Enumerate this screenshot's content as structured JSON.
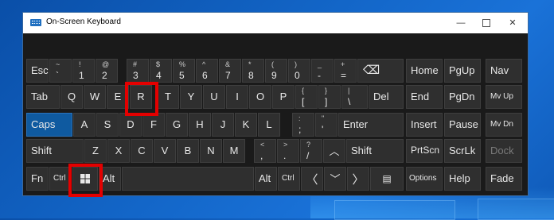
{
  "window": {
    "title": "On-Screen Keyboard",
    "min_symbol": "—",
    "close_symbol": "✕"
  },
  "keys": {
    "esc": "Esc",
    "n1_sub": "!",
    "n1": "1",
    "n2_sub": "@",
    "n2": "2",
    "n3_sub": "#",
    "n3": "3",
    "n4_sub": "$",
    "n4": "4",
    "n5_sub": "%",
    "n5": "5",
    "n6_sub": "^",
    "n6": "6",
    "n7_sub": "&",
    "n7": "7",
    "n8_sub": "*",
    "n8": "8",
    "n9_sub": "(",
    "n9": "9",
    "n0_sub": ")",
    "n0": "0",
    "minus_sub": "_",
    "minus": "-",
    "eq_sub": "+",
    "eq": "=",
    "bksp": "⌫",
    "tilde_sub": "~",
    "tilde": "`",
    "tab": "Tab",
    "q": "Q",
    "w": "W",
    "e": "E",
    "r": "R",
    "t": "T",
    "y": "Y",
    "u": "U",
    "i": "I",
    "o": "O",
    "p": "P",
    "lbr_sub": "{",
    "lbr": "[",
    "rbr_sub": "}",
    "rbr": "]",
    "bs_sub": "|",
    "bs": "\\",
    "del": "Del",
    "caps": "Caps",
    "a": "A",
    "s": "S",
    "d": "D",
    "f": "F",
    "g": "G",
    "h": "H",
    "j": "J",
    "k": "K",
    "l": "L",
    "semi_sub": ":",
    "semi": ";",
    "quote_sub": "\"",
    "quote": "'",
    "enter": "Enter",
    "shift": "Shift",
    "z": "Z",
    "x": "X",
    "c": "C",
    "v": "V",
    "b": "B",
    "n": "N",
    "m": "M",
    "comma_sub": "<",
    "comma": ",",
    "period_sub": ">",
    "period": ".",
    "slash_sub": "?",
    "slash": "/",
    "up": "︿",
    "shift_r": "Shift",
    "fn": "Fn",
    "ctrl": "Ctrl",
    "win": "windows-logo",
    "alt": "Alt",
    "alt_r": "Alt",
    "ctrl_r": "Ctrl",
    "left": "〈",
    "down": "﹀",
    "right": "〉",
    "menu": "▤",
    "home": "Home",
    "pgup": "PgUp",
    "nav": "Nav",
    "end": "End",
    "pgdn": "PgDn",
    "mvup": "Mv Up",
    "insert": "Insert",
    "pause": "Pause",
    "mvdn": "Mv Dn",
    "prtscn": "PrtScn",
    "scrlk": "ScrLk",
    "dock": "Dock",
    "options": "Options",
    "help": "Help",
    "fade": "Fade"
  },
  "colors": {
    "key_bg": "#2f2f2f",
    "active_key": "#0f5aa0",
    "highlight": "#e40000",
    "desktop": "#1366c8"
  }
}
